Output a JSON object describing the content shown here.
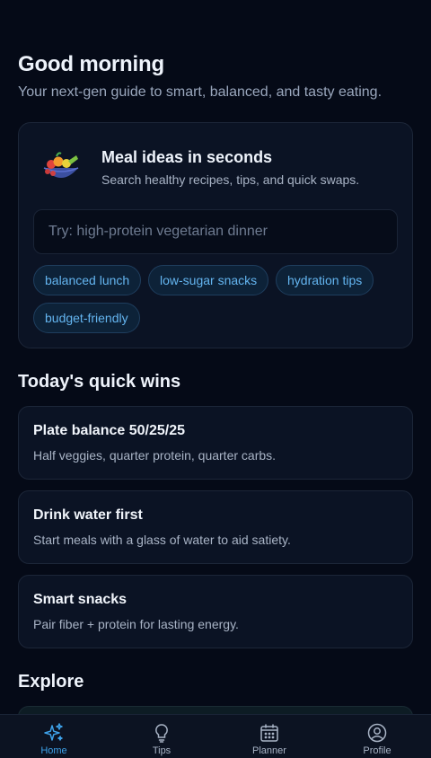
{
  "header": {
    "greeting": "Good morning",
    "subtitle": "Your next-gen guide to smart, balanced, and tasty eating."
  },
  "search_card": {
    "icon": "fruit-bowl-icon",
    "title": "Meal ideas in seconds",
    "subtitle": "Search healthy recipes, tips, and quick swaps.",
    "input_value": "",
    "placeholder": "Try: high-protein vegetarian dinner",
    "chips": [
      "balanced lunch",
      "low-sugar snacks",
      "hydration tips",
      "budget-friendly"
    ]
  },
  "quick_wins": {
    "title": "Today's quick wins",
    "items": [
      {
        "title": "Plate balance 50/25/25",
        "desc": "Half veggies, quarter protein, quarter carbs."
      },
      {
        "title": "Drink water first",
        "desc": "Start meals with a glass of water to aid satiety."
      },
      {
        "title": "Smart snacks",
        "desc": "Pair fiber + protein for lasting energy."
      }
    ]
  },
  "explore": {
    "title": "Explore"
  },
  "nav": {
    "items": [
      {
        "label": "Home",
        "icon": "sparkles-icon",
        "active": true
      },
      {
        "label": "Tips",
        "icon": "lightbulb-icon",
        "active": false
      },
      {
        "label": "Planner",
        "icon": "calendar-icon",
        "active": false
      },
      {
        "label": "Profile",
        "icon": "user-circle-icon",
        "active": false
      }
    ]
  },
  "colors": {
    "background": "#050a17",
    "card": "#0b1324",
    "accent": "#3ea2ea",
    "chip_text": "#64b5f0"
  }
}
